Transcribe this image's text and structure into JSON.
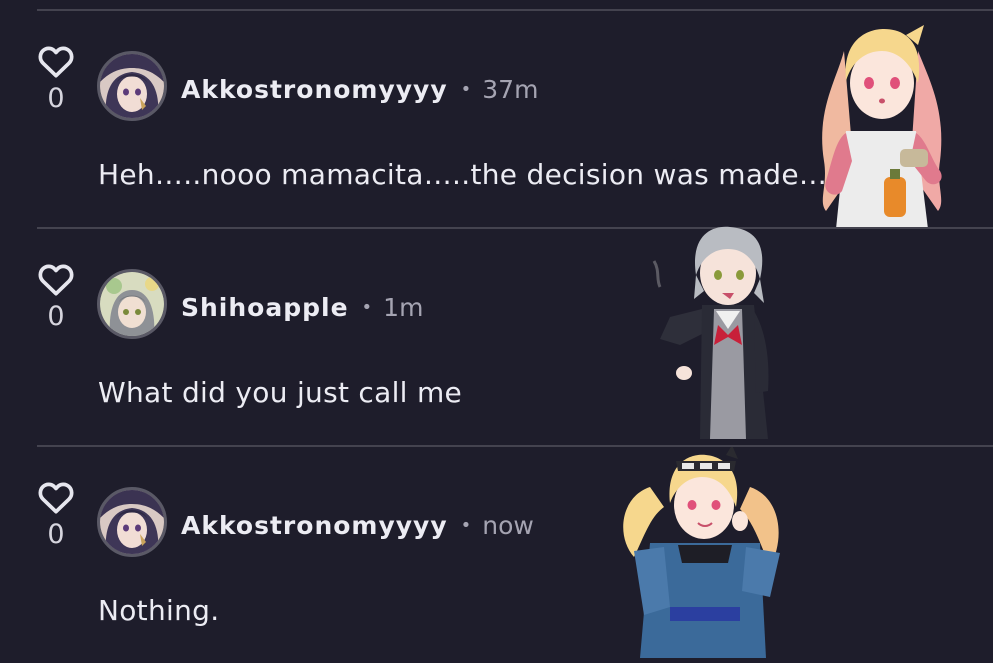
{
  "comments": [
    {
      "username": "Akkostronomyyyy",
      "separator": "•",
      "time": "37m",
      "text": "Heh…..nooo mamacita…..the decision was made…",
      "likes": "0",
      "avatar": "purple-hair-avatar",
      "sticker": "blonde-pink-hair-girl-holding-drink"
    },
    {
      "username": "Shihoapple",
      "separator": "•",
      "time": "1m",
      "text": "What did you just call me",
      "likes": "0",
      "avatar": "grey-hair-avatar",
      "sticker": "grey-hair-girl-school-uniform"
    },
    {
      "username": "Akkostronomyyyy",
      "separator": "•",
      "time": "now",
      "text": "Nothing.",
      "likes": "0",
      "avatar": "purple-hair-avatar",
      "sticker": "blonde-twintail-girl-denim-outfit"
    }
  ],
  "colors": {
    "background": "#1e1d2b",
    "divider": "#44434f",
    "text_primary": "#ececf3",
    "text_secondary": "#a5a4b2"
  }
}
